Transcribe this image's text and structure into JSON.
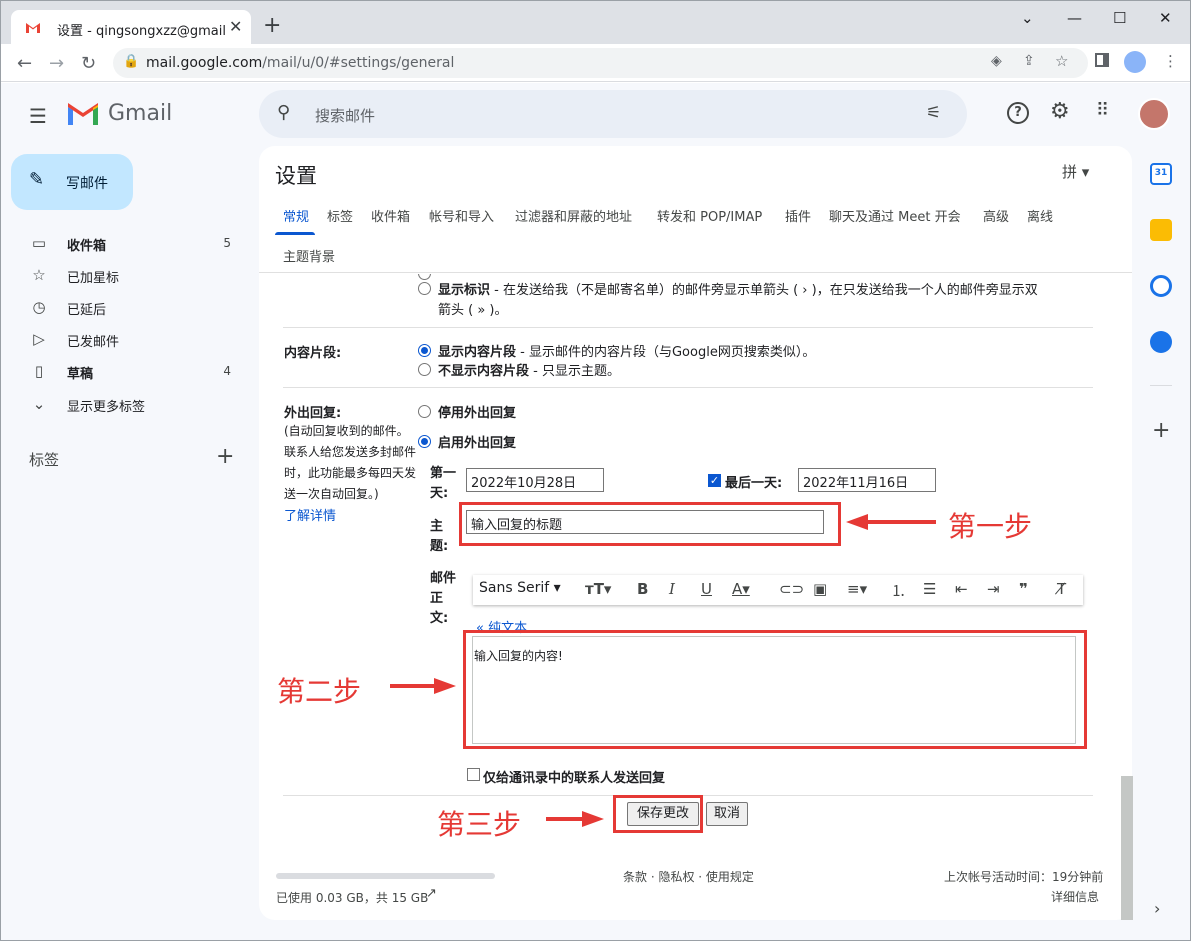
{
  "browser": {
    "tab_title": "设置 - qingsongxzz@gmail.com",
    "url_host": "mail.google.com",
    "url_path": "/mail/u/0/#settings/general"
  },
  "gmail": {
    "logo_text": "Gmail",
    "search_placeholder": "搜索邮件",
    "compose_label": "写邮件",
    "nav": [
      {
        "label": "收件箱",
        "count": "5",
        "icon": "inbox-icon"
      },
      {
        "label": "已加星标",
        "count": "",
        "icon": "star-icon"
      },
      {
        "label": "已延后",
        "count": "",
        "icon": "clock-icon"
      },
      {
        "label": "已发邮件",
        "count": "",
        "icon": "send-icon"
      },
      {
        "label": "草稿",
        "count": "4",
        "icon": "draft-icon"
      },
      {
        "label": "显示更多标签",
        "count": "",
        "icon": "chevron-down-icon"
      }
    ],
    "labels_heading": "标签"
  },
  "settings": {
    "title": "设置",
    "ime": "拼",
    "tabs": [
      "常规",
      "标签",
      "收件箱",
      "帐号和导入",
      "过滤器和屏蔽的地址",
      "转发和 POP/IMAP",
      "插件",
      "聊天及通过 Meet 开会",
      "高级",
      "离线",
      "主题背景"
    ],
    "active_tab": "常规",
    "indicator_option_bold": "显示标识",
    "indicator_option_text": " - 在发送给我（不是邮寄名单）的邮件旁显示单箭头 ( › )，在只发送给我一个人的邮件旁显示双",
    "indicator_option_text2": "箭头 ( » )。",
    "snippets_label": "内容片段:",
    "snippets_on_bold": "显示内容片段",
    "snippets_on_text": " - 显示邮件的内容片段（与Google网页搜索类似）。",
    "snippets_off_bold": "不显示内容片段",
    "snippets_off_text": " - 只显示主题。",
    "vacation_label": "外出回复:",
    "vacation_desc": [
      "(自动回复收到的邮件。",
      "联系人给您发送多封邮件",
      "时，此功能最多每四天发",
      "送一次自动回复。)"
    ],
    "learn_more": "了解详情",
    "vacation_off": "停用外出回复",
    "vacation_on": "启用外出回复",
    "first_day_label": [
      "第一",
      "天:"
    ],
    "first_day_value": "2022年10月28日",
    "last_day_label": "最后一天:",
    "last_day_value": "2022年11月16日",
    "subject_label": [
      "主",
      "题:"
    ],
    "subject_value": "输入回复的标题",
    "body_label": [
      "邮件",
      "正",
      "文:"
    ],
    "font_name": "Sans Serif",
    "plain_text_link": "« 纯文本",
    "body_value": "输入回复的内容!",
    "contacts_only": "仅给通讯录中的联系人发送回复",
    "save_button": "保存更改",
    "cancel_button": "取消"
  },
  "annotations": {
    "step1": "第一步",
    "step2": "第二步",
    "step3": "第三步"
  },
  "footer": {
    "storage": "已使用 0.03 GB，共 15 GB",
    "links": "条款 · 隐私权 · 使用规定",
    "last_activity": "上次帐号活动时间：19分钟前",
    "details": "详细信息"
  },
  "colors": {
    "accent": "#0b57d0",
    "compose_bg": "#c2e7ff",
    "annotation": "#e53935"
  }
}
